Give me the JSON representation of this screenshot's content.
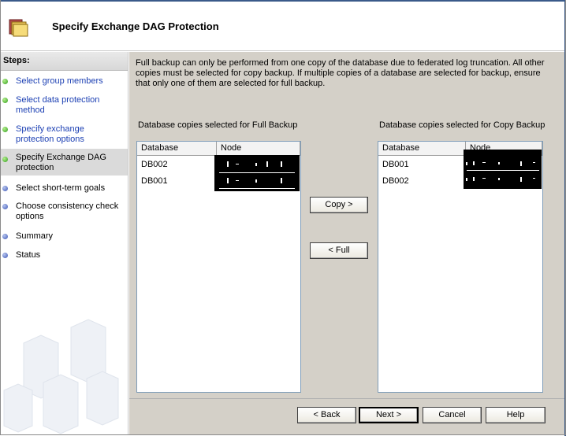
{
  "header": {
    "title": "Specify Exchange DAG Protection",
    "icon": "folder-icon"
  },
  "sidebar": {
    "title": "Steps:",
    "items": [
      {
        "label": "Select group members",
        "state": "done"
      },
      {
        "label": "Select data protection method",
        "state": "done"
      },
      {
        "label": "Specify exchange protection options",
        "state": "done"
      },
      {
        "label": "Specify Exchange DAG protection",
        "state": "current"
      },
      {
        "label": "Select short-term goals",
        "state": "todo"
      },
      {
        "label": "Choose consistency check options",
        "state": "todo"
      },
      {
        "label": "Summary",
        "state": "todo"
      },
      {
        "label": "Status",
        "state": "todo"
      }
    ]
  },
  "main": {
    "info_text": "Full backup can only be performed from one copy of the database due to federated log truncation. All other copies must be selected for copy backup. If multiple copies of a database are selected for backup, ensure that only one of them are selected for full backup.",
    "full_backup": {
      "label": "Database copies selected for Full Backup",
      "columns": [
        "Database",
        "Node"
      ],
      "rows": [
        {
          "database": "DB002",
          "node": "[redacted]"
        },
        {
          "database": "DB001",
          "node": "[redacted]"
        }
      ]
    },
    "copy_backup": {
      "label": "Database copies selected for Copy Backup",
      "columns": [
        "Database",
        "Node"
      ],
      "rows": [
        {
          "database": "DB001",
          "node": "[redacted]"
        },
        {
          "database": "DB002",
          "node": "[redacted]"
        }
      ]
    },
    "copy_button": "Copy >",
    "full_button": "< Full"
  },
  "footer": {
    "back": "< Back",
    "next": "Next >",
    "cancel": "Cancel",
    "help": "Help"
  },
  "colors": {
    "panel": "#d4d0c8",
    "link": "#1b3fb3",
    "done_dot": "#2e9d1a",
    "todo_dot": "#3a55b5",
    "window_border": "#3a5a8a"
  }
}
